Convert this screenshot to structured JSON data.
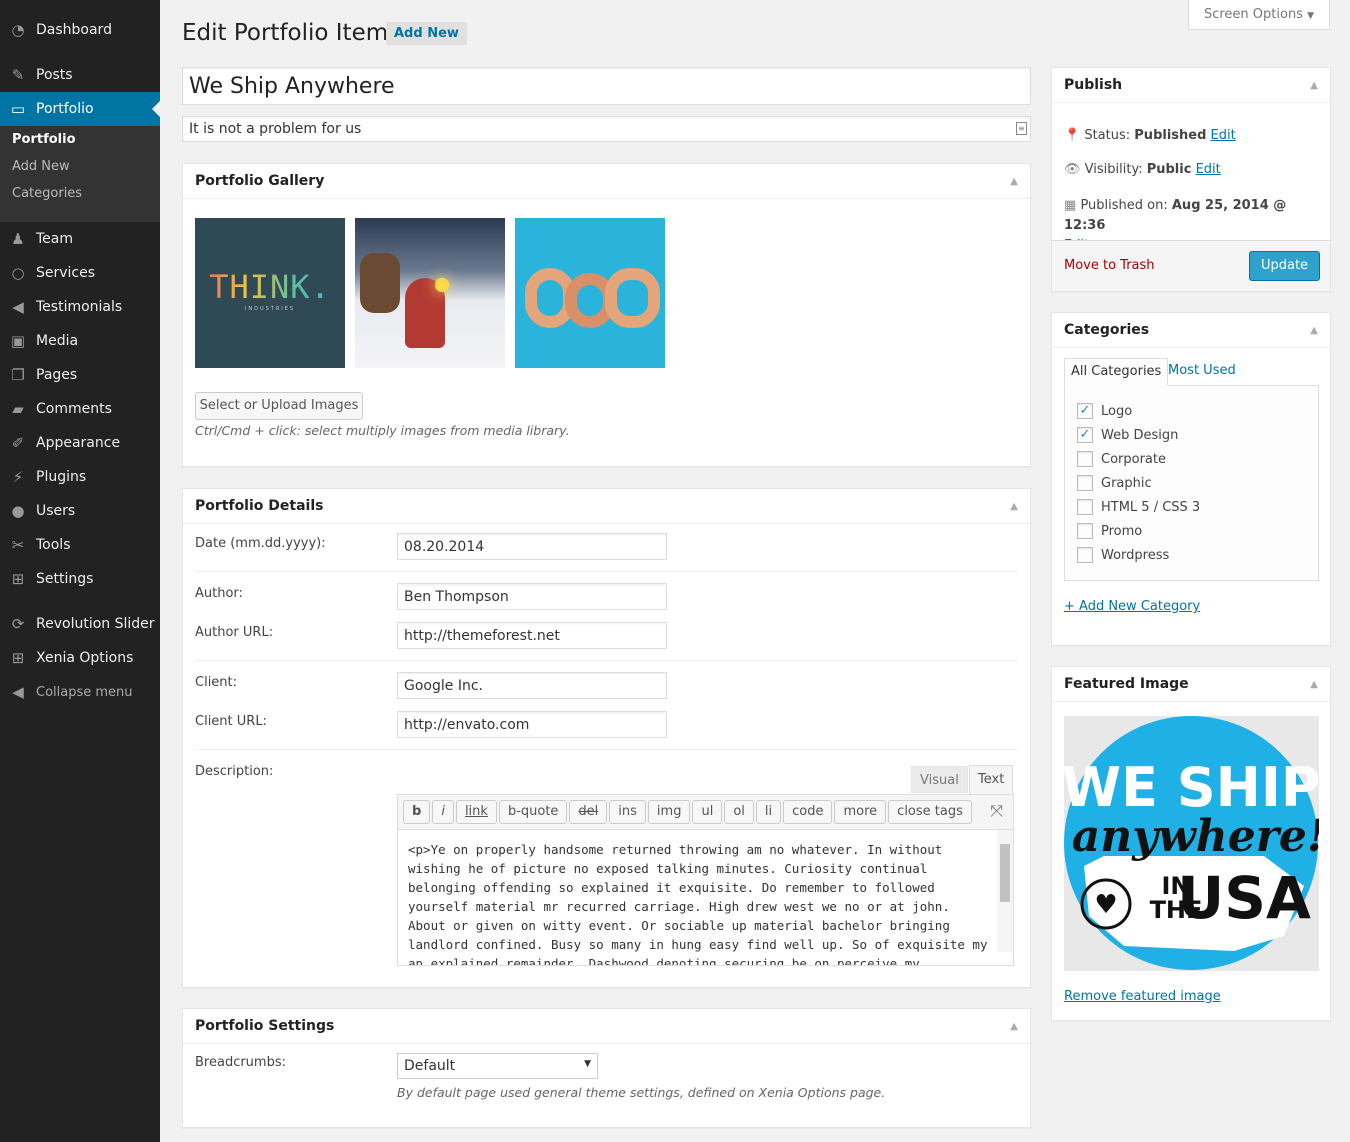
{
  "sidebar": {
    "items": [
      {
        "label": "Dashboard",
        "icon": "dashboard-icon"
      },
      {
        "label": "Posts",
        "icon": "pin-icon"
      },
      {
        "label": "Portfolio",
        "icon": "folder-icon"
      },
      {
        "label": "Team",
        "icon": "person-icon"
      },
      {
        "label": "Services",
        "icon": "circle-icon"
      },
      {
        "label": "Testimonials",
        "icon": "megaphone-icon"
      },
      {
        "label": "Media",
        "icon": "media-icon"
      },
      {
        "label": "Pages",
        "icon": "pages-icon"
      },
      {
        "label": "Comments",
        "icon": "comment-icon"
      },
      {
        "label": "Appearance",
        "icon": "brush-icon"
      },
      {
        "label": "Plugins",
        "icon": "plug-icon"
      },
      {
        "label": "Users",
        "icon": "user-icon"
      },
      {
        "label": "Tools",
        "icon": "wrench-icon"
      },
      {
        "label": "Settings",
        "icon": "settings-icon"
      },
      {
        "label": "Revolution Slider",
        "icon": "refresh-icon"
      },
      {
        "label": "Xenia Options",
        "icon": "grid-icon"
      }
    ],
    "submenu": [
      "Portfolio",
      "Add New",
      "Categories"
    ],
    "collapse": "Collapse menu"
  },
  "header": {
    "title": "Edit Portfolio Item",
    "add_new": "Add New",
    "screen_options": "Screen Options"
  },
  "post": {
    "title": "We Ship Anywhere",
    "subtitle": "It is not a problem for us"
  },
  "gallery": {
    "title": "Portfolio Gallery",
    "thumb1_text": "THINK.",
    "thumb1_sub": "INDUSTRIES",
    "upload_button": "Select or Upload Images",
    "hint": "Ctrl/Cmd + click: select multiply images from media library."
  },
  "details": {
    "title": "Portfolio Details",
    "date_label": "Date (mm.dd.yyyy):",
    "date": "08.20.2014",
    "author_label": "Author:",
    "author": "Ben Thompson",
    "author_url_label": "Author URL:",
    "author_url": "http://themeforest.net",
    "client_label": "Client:",
    "client": "Google Inc.",
    "client_url_label": "Client URL:",
    "client_url": "http://envato.com",
    "description_label": "Description:",
    "tab_visual": "Visual",
    "tab_text": "Text",
    "quicktags": [
      "b",
      "i",
      "link",
      "b-quote",
      "del",
      "ins",
      "img",
      "ul",
      "ol",
      "li",
      "code",
      "more",
      "close tags"
    ],
    "content": "<p>Ye on properly handsome returned throwing am no whatever. In without wishing he of picture no exposed talking minutes. Curiosity continual belonging offending so explained it exquisite. Do remember to followed yourself material mr recurred carriage. High drew west we no or at john. About or given on witty event. Or sociable up material bachelor bringing landlord confined. Busy so many in hung easy find well up. So of exquisite my an explained remainder. Dashwood denoting securing be on perceive my"
  },
  "settings": {
    "title": "Portfolio Settings",
    "breadcrumbs_label": "Breadcrumbs:",
    "breadcrumbs": "Default",
    "hint": "By default page used general theme settings, defined on Xenia Options page."
  },
  "publish": {
    "title": "Publish",
    "status_label": "Status:",
    "status": "Published",
    "visibility_label": "Visibility:",
    "visibility": "Public",
    "published_label": "Published on:",
    "published": "Aug 25, 2014 @ 12:36",
    "edit": "Edit",
    "trash": "Move to Trash",
    "update": "Update"
  },
  "categories": {
    "title": "Categories",
    "tab_all": "All Categories",
    "tab_used": "Most Used",
    "items": [
      {
        "label": "Logo",
        "checked": true
      },
      {
        "label": "Web Design",
        "checked": true
      },
      {
        "label": "Corporate",
        "checked": false
      },
      {
        "label": "Graphic",
        "checked": false
      },
      {
        "label": "HTML 5 / CSS 3",
        "checked": false
      },
      {
        "label": "Promo",
        "checked": false
      },
      {
        "label": "Wordpress",
        "checked": false
      }
    ],
    "add_new": "+ Add New Category"
  },
  "featured": {
    "title": "Featured Image",
    "image_text": "WE SHIP anywhere! IN THE USA",
    "remove": "Remove featured image"
  },
  "colors": {
    "accent": "#0074a2",
    "sidebar": "#222222",
    "button": "#2ea2cc"
  }
}
